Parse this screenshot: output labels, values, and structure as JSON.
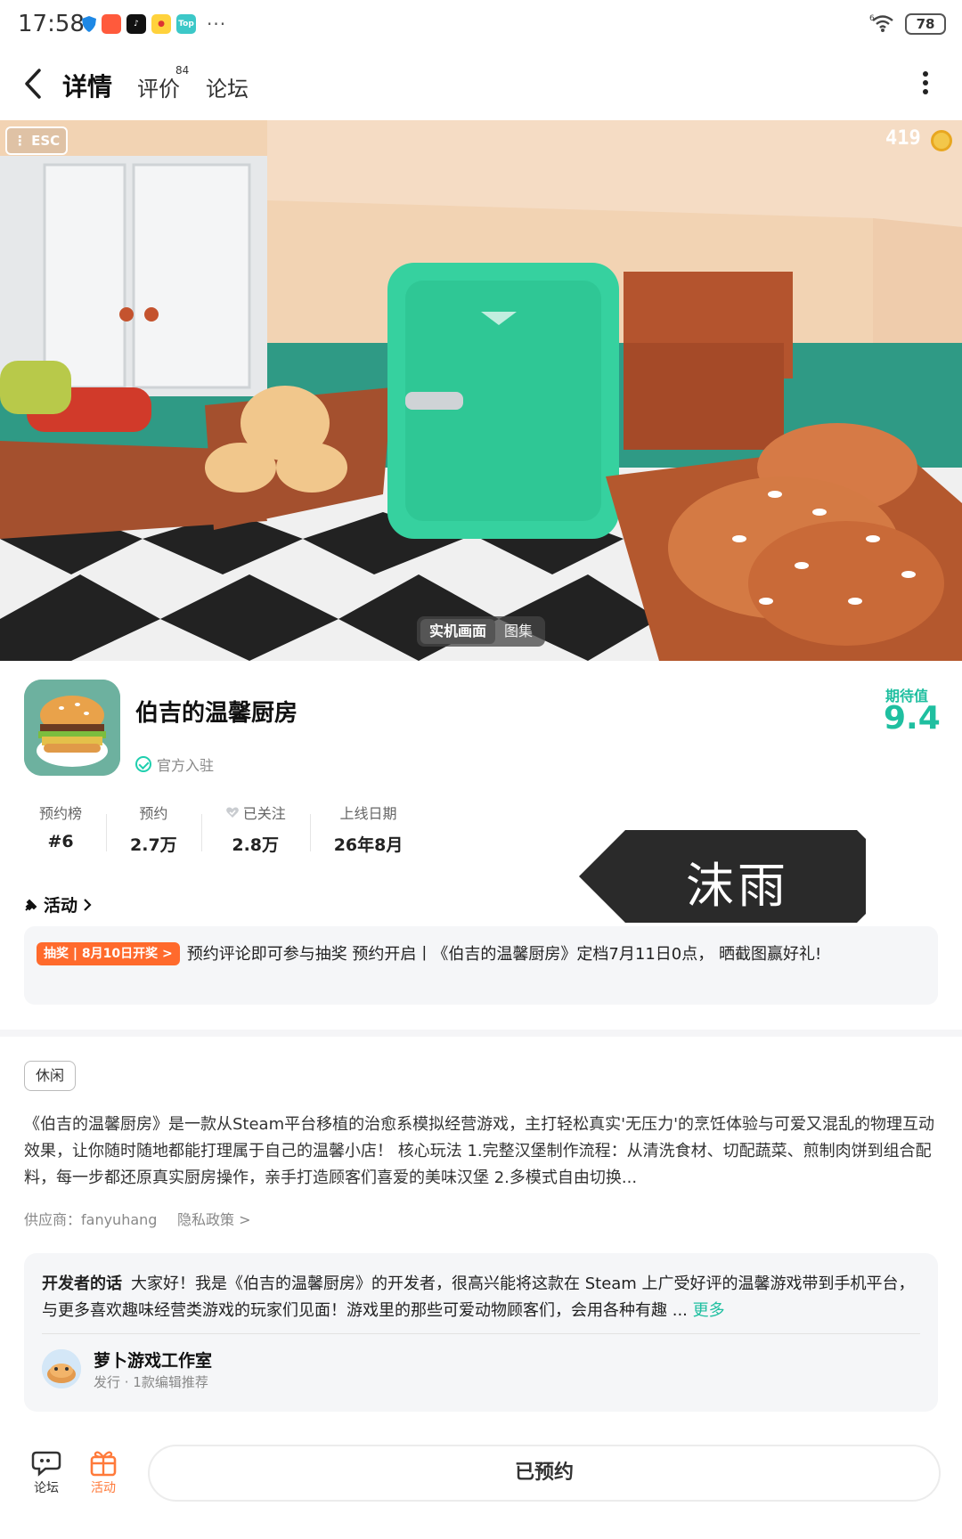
{
  "status_bar": {
    "time": "17:58",
    "battery": "78",
    "notification_icons": [
      "shield-icon",
      "app-icon",
      "tiktok-icon",
      "weibo-icon",
      "top-icon"
    ],
    "more": "···",
    "top_label": "Top",
    "wifi_label": "6"
  },
  "nav": {
    "tabs": [
      {
        "label": "详情",
        "active": true
      },
      {
        "label": "评价",
        "count": "84"
      },
      {
        "label": "论坛"
      }
    ]
  },
  "hero": {
    "esc_label": "ESC",
    "coins": "419",
    "media_tabs": [
      "实机画面",
      "图集"
    ]
  },
  "game": {
    "title": "伯吉的温馨厨房",
    "official": "官方入驻",
    "score_label": "期待值",
    "score": "9.4"
  },
  "stats": [
    {
      "label": "预约榜",
      "value": "#6"
    },
    {
      "label": "预约",
      "value": "2.7万"
    },
    {
      "label": "已关注",
      "value": "2.8万"
    },
    {
      "label": "上线日期",
      "value": "26年8月"
    }
  ],
  "watermark": "沫雨",
  "activity": {
    "heading": "活动",
    "badge": "抽奖 | 8月10日开奖 >",
    "text": "预约评论即可参与抽奖 预约开启丨《伯吉的温馨厨房》定档7月11日0点， 晒截图赢好礼!"
  },
  "details": {
    "tag": "休闲",
    "description": "《伯吉的温馨厨房》是一款从Steam平台移植的治愈系模拟经营游戏，主打轻松真实'无压力'的烹饪体验与可爱又混乱的物理互动效果，让你随时随地都能打理属于自己的温馨小店！ 核心玩法 1.完整汉堡制作流程：从清洗食材、切配蔬菜、煎制肉饼到组合配料，每一步都还原真实厨房操作，亲手打造顾客们喜爱的美味汉堡 2.多模式自由切换...",
    "supplier": "供应商：fanyuhang",
    "privacy": "隐私政策 >"
  },
  "developer": {
    "label": "开发者的话",
    "text": "大家好！我是《伯吉的温馨厨房》的开发者，很高兴能将这款在 Steam 上广受好评的温馨游戏带到手机平台，与更多喜欢趣味经营类游戏的玩家们见面！游戏里的那些可爱动物顾客们，会用各种有趣 ... ",
    "more": "更多",
    "studio": "萝卜游戏工作室",
    "sub": "发行 · 1款编辑推荐"
  },
  "bottom": {
    "forum": "论坛",
    "activity": "活动",
    "reserve": "已预约"
  },
  "colors": {
    "accent": "#1fcfae",
    "score": "#1fbfa0",
    "badge": "#ff6a2c",
    "activity_icon": "#ff7a3a"
  }
}
